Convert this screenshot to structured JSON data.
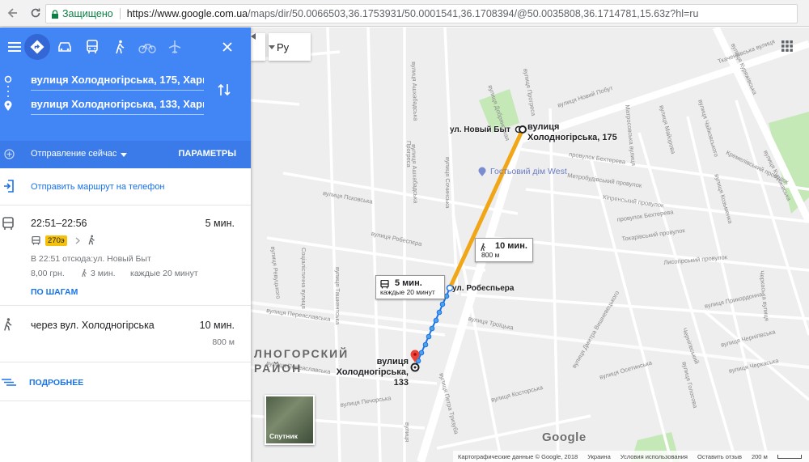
{
  "browser": {
    "secure_label": "Защищено",
    "url_base": "https://www.google.com.ua",
    "url_rest": "/maps/dir/50.0066503,36.1753931/50.0001541,36.1708394/@50.0035808,36.1714781,15.63z?hl=ru"
  },
  "directions": {
    "origin": "вулиця Холодногірська, 175, Харків, Харківська область",
    "destination": "вулиця Холодногірська, 133, Харків, Харківська область",
    "depart_label": "Отправление сейчас",
    "params_label": "ПАРАМЕТРЫ",
    "send_to_phone": "Отправить маршрут на телефон",
    "transit": {
      "time_range": "22:51–22:56",
      "duration": "5 мин.",
      "route_number": "270э",
      "depart_info": "В 22:51 отсюда:ул. Новый Быт",
      "price": "8,00 грн.",
      "walk": "3 мин.",
      "frequency": "каждые 20 минут",
      "steps_label": "ПО ШАГАМ"
    },
    "walking": {
      "via": "через вул. Холодногірська",
      "duration": "10 мин.",
      "distance": "800 м"
    },
    "more_label": "ПОДРОБНЕЕ"
  },
  "map": {
    "lang": "Ру",
    "walk_popup": {
      "time": "10 мин.",
      "distance": "800 м"
    },
    "bus_popup": {
      "time": "5 мин.",
      "freq": "каждые 20 минут"
    },
    "origin_stop": "ул. Новый Быт",
    "origin_name": "вулиця Холодногірська, 175",
    "mid_stop": "ул. Робеспьера",
    "dest_name": "вулиця Холодногірська, 133",
    "poi": "Гостьовий дім West",
    "district": [
      "ЛНОГОРСКИЙ",
      "РАЙОН"
    ],
    "satellite_label": "Спутник",
    "logo": "Google",
    "footer": [
      "Картографические данные © Google, 2018",
      "Украина",
      "Условия использования",
      "Оставить отзыв",
      "200 м"
    ],
    "streets": [
      "вулиця Новий Побут",
      "Ткаченківська вулиця",
      "вулиця Куряжівська",
      "вулиця Куряжівська",
      "вулиця Добрянськая",
      "вулиця Прогреса",
      "вулиця Ашхабадська",
      "вулиця Ашхабадська",
      "вулиця Псковська",
      "вулиця Робеспєра",
      "вулиця Сочинська",
      "Прогреса",
      "Соціалістична вулиця",
      "вулиця Ташкентська",
      "вулиця Ревуцького",
      "вулиця Переяславська",
      "вулиця Переяславська",
      "Матросовська вулиця",
      "вулиця Майорова",
      "провулок Бехтерева",
      "Кіпренський провулок",
      "Метробудівський провулок",
      "провулок Бехтерева",
      "Токарівський провулок",
      "Лисогірський провулок",
      "вулиця Троїцька",
      "вулиця Прикордонна",
      "вулиця Черкаська",
      "вулиця Чернігівська",
      "вулиця Печорська",
      "вулиця Петра Тризуба",
      "вулиця Осетинська",
      "вулиця Косторська",
      "Черкаська вулиця",
      "Чернігівський",
      "вулиця Дмитра Вишневецького",
      "вулиця Козьменка",
      "вулиця Чайковського",
      "Кремелівський провулок",
      "вулиця Голосова",
      "вулиця"
    ]
  }
}
